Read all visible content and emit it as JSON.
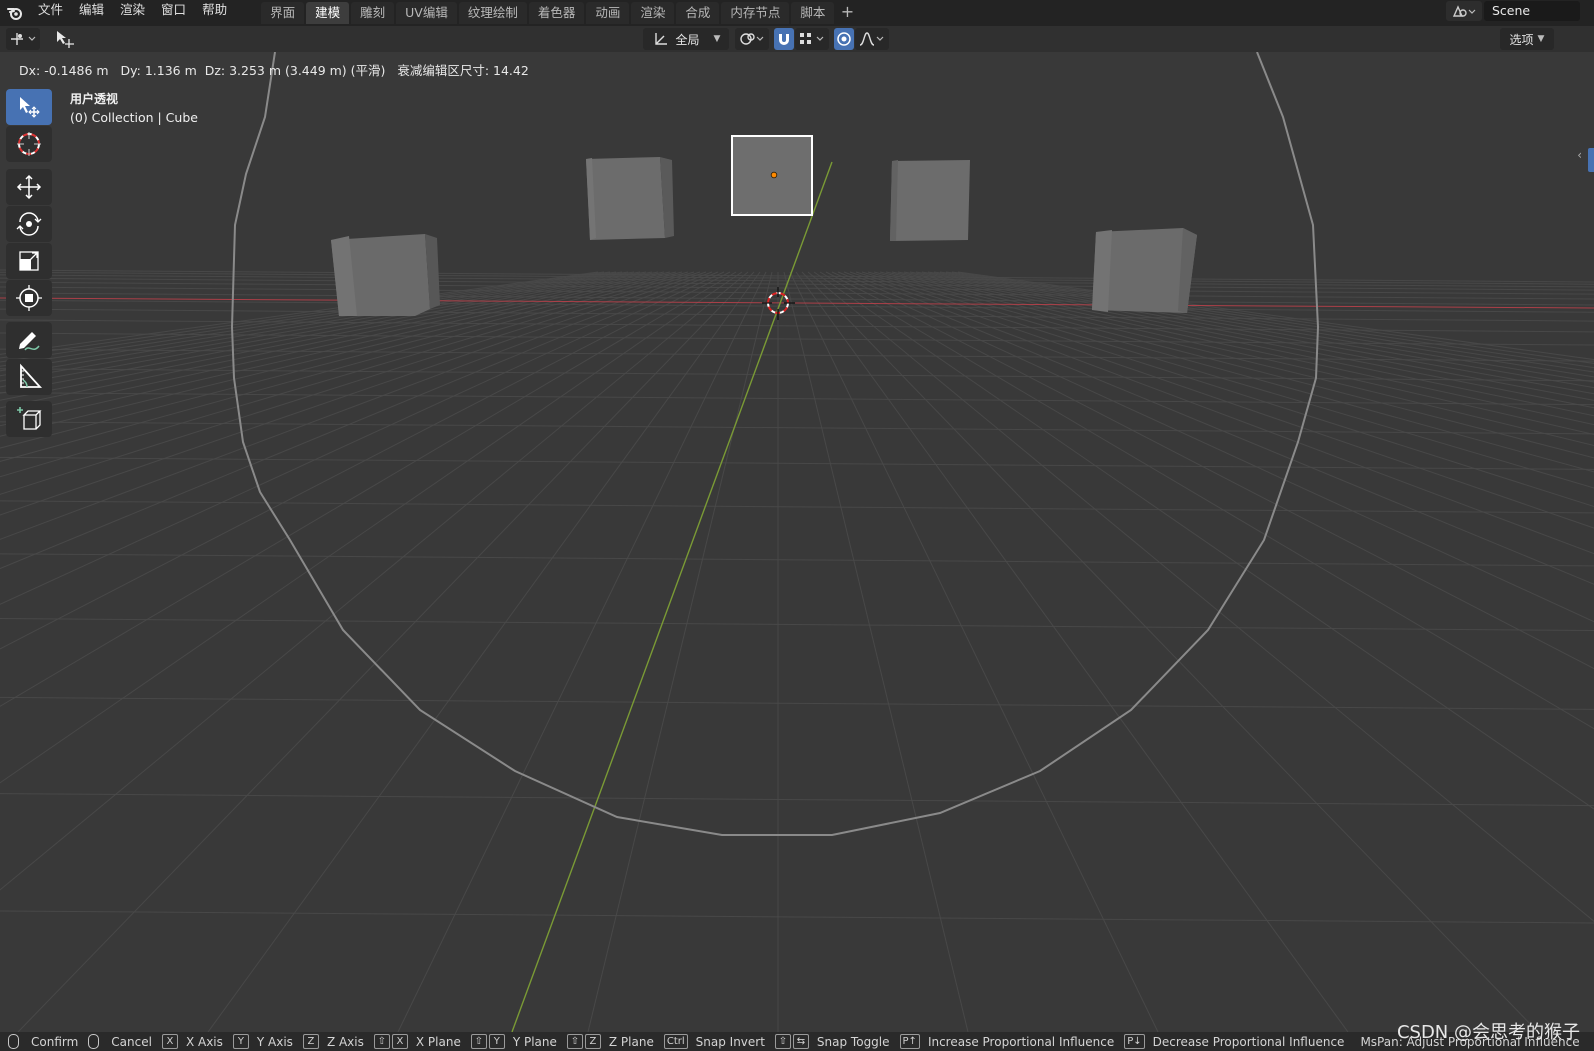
{
  "menu": [
    "文件",
    "编辑",
    "渲染",
    "窗口",
    "帮助"
  ],
  "workspace_tabs": [
    "界面",
    "建模",
    "雕刻",
    "UV编辑",
    "纹理绘制",
    "着色器",
    "动画",
    "渲染",
    "合成",
    "内存节点",
    "脚本"
  ],
  "active_tab_index": 1,
  "scene_name": "Scene",
  "header": {
    "orientation": "全局",
    "options": "选项"
  },
  "transform_info": "Dx: -0.1486 m   Dy: 1.136 m  Dz: 3.253 m (3.449 m) (平滑)   衰减编辑区尺寸: 14.42",
  "view": {
    "name": "用户透视",
    "collection": "(0) Collection | Cube"
  },
  "status_bar": [
    {
      "keys": [],
      "mouse": true,
      "label": "Confirm"
    },
    {
      "keys": [],
      "mouse": true,
      "label": "Cancel"
    },
    {
      "keys": [
        "X"
      ],
      "label": "X Axis"
    },
    {
      "keys": [
        "Y"
      ],
      "label": "Y Axis"
    },
    {
      "keys": [
        "Z"
      ],
      "label": "Z Axis"
    },
    {
      "keys": [
        "⇧",
        "X"
      ],
      "label": "X Plane"
    },
    {
      "keys": [
        "⇧",
        "Y"
      ],
      "label": "Y Plane"
    },
    {
      "keys": [
        "⇧",
        "Z"
      ],
      "label": "Z Plane"
    },
    {
      "keys": [
        "Ctrl"
      ],
      "label": "Snap Invert"
    },
    {
      "keys": [
        "⇧",
        "⇆"
      ],
      "label": "Snap Toggle"
    },
    {
      "keys": [
        "P↑"
      ],
      "label": "Increase Proportional Influence"
    },
    {
      "keys": [
        "P↓"
      ],
      "label": "Decrease Proportional Influence"
    },
    {
      "keys": [],
      "label": "MsPan: Adjust Proportional Influence"
    }
  ],
  "watermark": "CSDN @会思考的猴子",
  "colors": {
    "accent": "#4772b3",
    "x_axis": "#c0414b",
    "y_axis": "#7a9a35",
    "origin": "#ff8a00"
  }
}
